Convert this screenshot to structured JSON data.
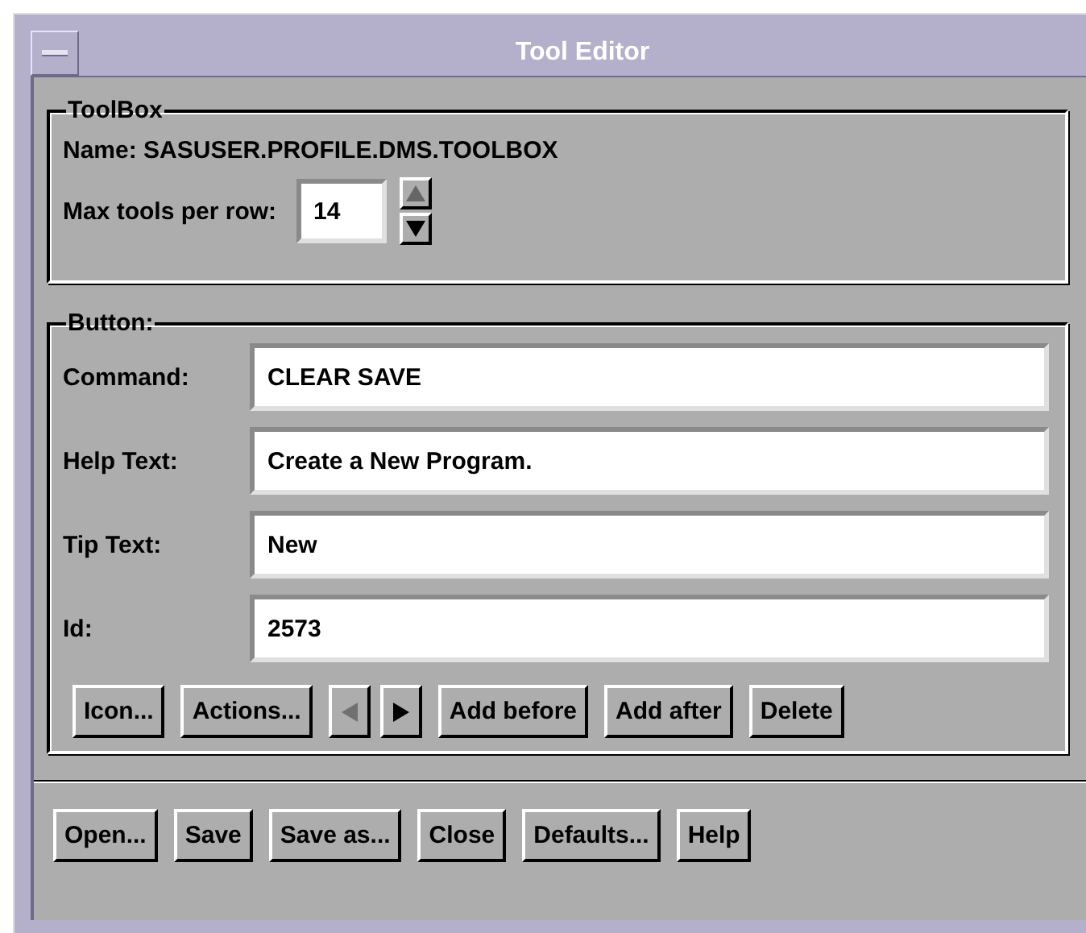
{
  "window": {
    "title": "Tool Editor"
  },
  "toolbox": {
    "legend": "ToolBox",
    "name_label": "Name: SASUSER.PROFILE.DMS.TOOLBOX",
    "max_label": "Max tools per row:",
    "max_value": "14",
    "spin_up_disabled": true,
    "spin_down_disabled": false
  },
  "button_group": {
    "legend": "Button:",
    "fields": [
      {
        "label": "Command:",
        "value": "CLEAR SAVE"
      },
      {
        "label": "Help Text:",
        "value": "Create a New Program."
      },
      {
        "label": "Tip Text:",
        "value": "New"
      },
      {
        "label": "Id:",
        "value": "2573"
      }
    ],
    "buttons": [
      {
        "kind": "text",
        "label": "Icon..."
      },
      {
        "kind": "text",
        "label": "Actions..."
      },
      {
        "kind": "prev",
        "disabled": true
      },
      {
        "kind": "next",
        "disabled": false
      },
      {
        "kind": "text",
        "label": "Add before"
      },
      {
        "kind": "text",
        "label": "Add after"
      },
      {
        "kind": "text",
        "label": "Delete"
      }
    ]
  },
  "footer_buttons": [
    "Open...",
    "Save",
    "Save as...",
    "Close",
    "Defaults...",
    "Help"
  ]
}
